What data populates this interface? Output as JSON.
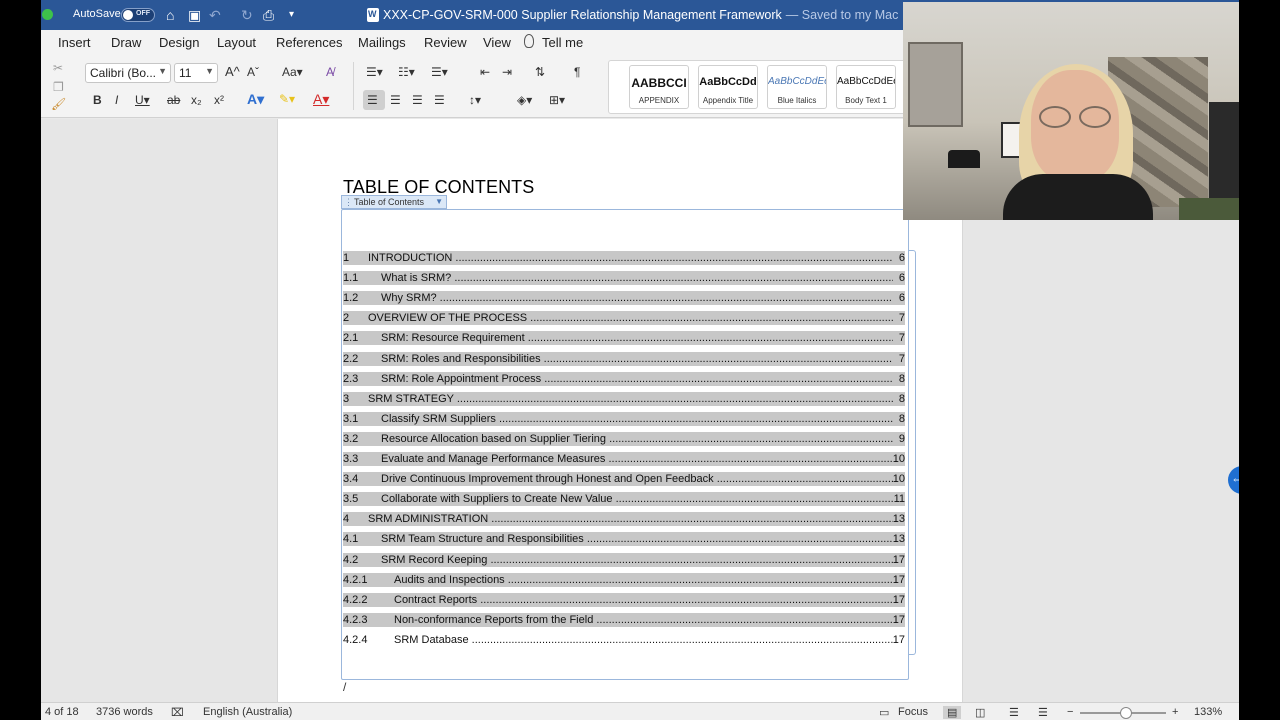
{
  "titlebar": {
    "autosave_label": "AutoSave",
    "autosave_state": "OFF",
    "document_title": "XXX-CP-GOV-SRM-000 Supplier Relationship Management Framework",
    "saved_status": "— Saved to my Mac"
  },
  "tabs": [
    "Insert",
    "Draw",
    "Design",
    "Layout",
    "References",
    "Mailings",
    "Review",
    "View"
  ],
  "tell_me": "Tell me",
  "ribbon": {
    "font_name": "Calibri (Bo...",
    "font_size": "11",
    "styles": [
      {
        "sample": "AABBCCI",
        "name": "APPENDIX"
      },
      {
        "sample": "AaBbCcDd",
        "name": "Appendix Title"
      },
      {
        "sample": "AaBbCcDdEe",
        "name": "Blue Italics"
      },
      {
        "sample": "AaBbCcDdEe",
        "name": "Body Text 1"
      }
    ]
  },
  "document": {
    "heading": "TABLE OF CONTENTS",
    "toc_tag": "Table of Contents",
    "toc": [
      {
        "num": "1",
        "title": "INTRODUCTION",
        "page": "6",
        "indent": 1
      },
      {
        "num": "1.1",
        "title": "What is SRM?",
        "page": "6",
        "indent": 2
      },
      {
        "num": "1.2",
        "title": "Why SRM?",
        "page": "6",
        "indent": 2
      },
      {
        "num": "2",
        "title": "OVERVIEW OF THE PROCESS",
        "page": "7",
        "indent": 1
      },
      {
        "num": "2.1",
        "title": "SRM: Resource Requirement",
        "page": "7",
        "indent": 2
      },
      {
        "num": "2.2",
        "title": "SRM: Roles and Responsibilities",
        "page": "7",
        "indent": 2
      },
      {
        "num": "2.3",
        "title": "SRM: Role Appointment Process",
        "page": "8",
        "indent": 2
      },
      {
        "num": "3",
        "title": "SRM STRATEGY",
        "page": "8",
        "indent": 1
      },
      {
        "num": "3.1",
        "title": "Classify SRM Suppliers",
        "page": "8",
        "indent": 2
      },
      {
        "num": "3.2",
        "title": "Resource Allocation based on Supplier Tiering",
        "page": "9",
        "indent": 2
      },
      {
        "num": "3.3",
        "title": "Evaluate and Manage Performance Measures",
        "page": "10",
        "indent": 2
      },
      {
        "num": "3.4",
        "title": "Drive Continuous Improvement through Honest and Open Feedback",
        "page": "10",
        "indent": 2
      },
      {
        "num": "3.5",
        "title": "Collaborate with Suppliers to Create New Value",
        "page": "11",
        "indent": 2
      },
      {
        "num": "4",
        "title": "SRM ADMINISTRATION",
        "page": "13",
        "indent": 1
      },
      {
        "num": "4.1",
        "title": "SRM Team Structure and Responsibilities",
        "page": "13",
        "indent": 2
      },
      {
        "num": "4.2",
        "title": "SRM Record Keeping",
        "page": "17",
        "indent": 2
      },
      {
        "num": "4.2.1",
        "title": "Audits and Inspections",
        "page": "17",
        "indent": 3
      },
      {
        "num": "4.2.2",
        "title": "Contract Reports",
        "page": "17",
        "indent": 3
      },
      {
        "num": "4.2.3",
        "title": "Non-conformance Reports from the Field",
        "page": "17",
        "indent": 3
      },
      {
        "num": "4.2.4",
        "title": "SRM Database",
        "page": "17",
        "indent": 3,
        "plain": true
      }
    ]
  },
  "statusbar": {
    "page_count": "4 of 18",
    "word_count": "3736 words",
    "language": "English (Australia)",
    "focus": "Focus",
    "zoom": "133%"
  }
}
